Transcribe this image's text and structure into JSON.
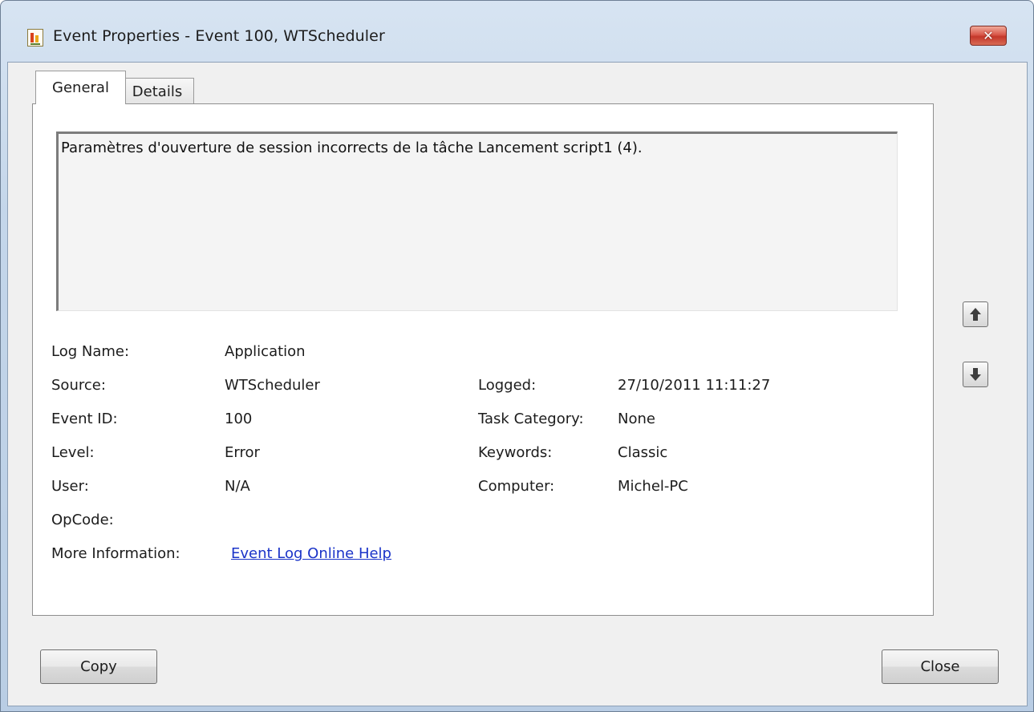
{
  "window": {
    "title": "Event Properties - Event 100, WTScheduler",
    "icon": "event-viewer-icon",
    "close_glyph": "✕"
  },
  "tabs": [
    {
      "label": "General",
      "selected": true
    },
    {
      "label": "Details",
      "selected": false
    }
  ],
  "description": "Paramètres d'ouverture de session incorrects de la tâche Lancement script1 (4).",
  "fields_left": [
    {
      "label": "Log Name:",
      "value": "Application"
    },
    {
      "label": "Source:",
      "value": "WTScheduler"
    },
    {
      "label": "Event ID:",
      "value": "100"
    },
    {
      "label": "Level:",
      "value": "Error"
    },
    {
      "label": "User:",
      "value": "N/A"
    },
    {
      "label": "OpCode:",
      "value": ""
    }
  ],
  "fields_right": [
    {
      "label": "Logged:",
      "value": "27/10/2011 11:11:27"
    },
    {
      "label": "Task Category:",
      "value": "None"
    },
    {
      "label": "Keywords:",
      "value": "Classic"
    },
    {
      "label": "Computer:",
      "value": "Michel-PC"
    }
  ],
  "more_info": {
    "label": "More Information:",
    "link": "Event Log Online Help"
  },
  "nav": {
    "up_icon": "arrow-up-icon",
    "down_icon": "arrow-down-icon"
  },
  "buttons": {
    "copy": "Copy",
    "close": "Close"
  }
}
